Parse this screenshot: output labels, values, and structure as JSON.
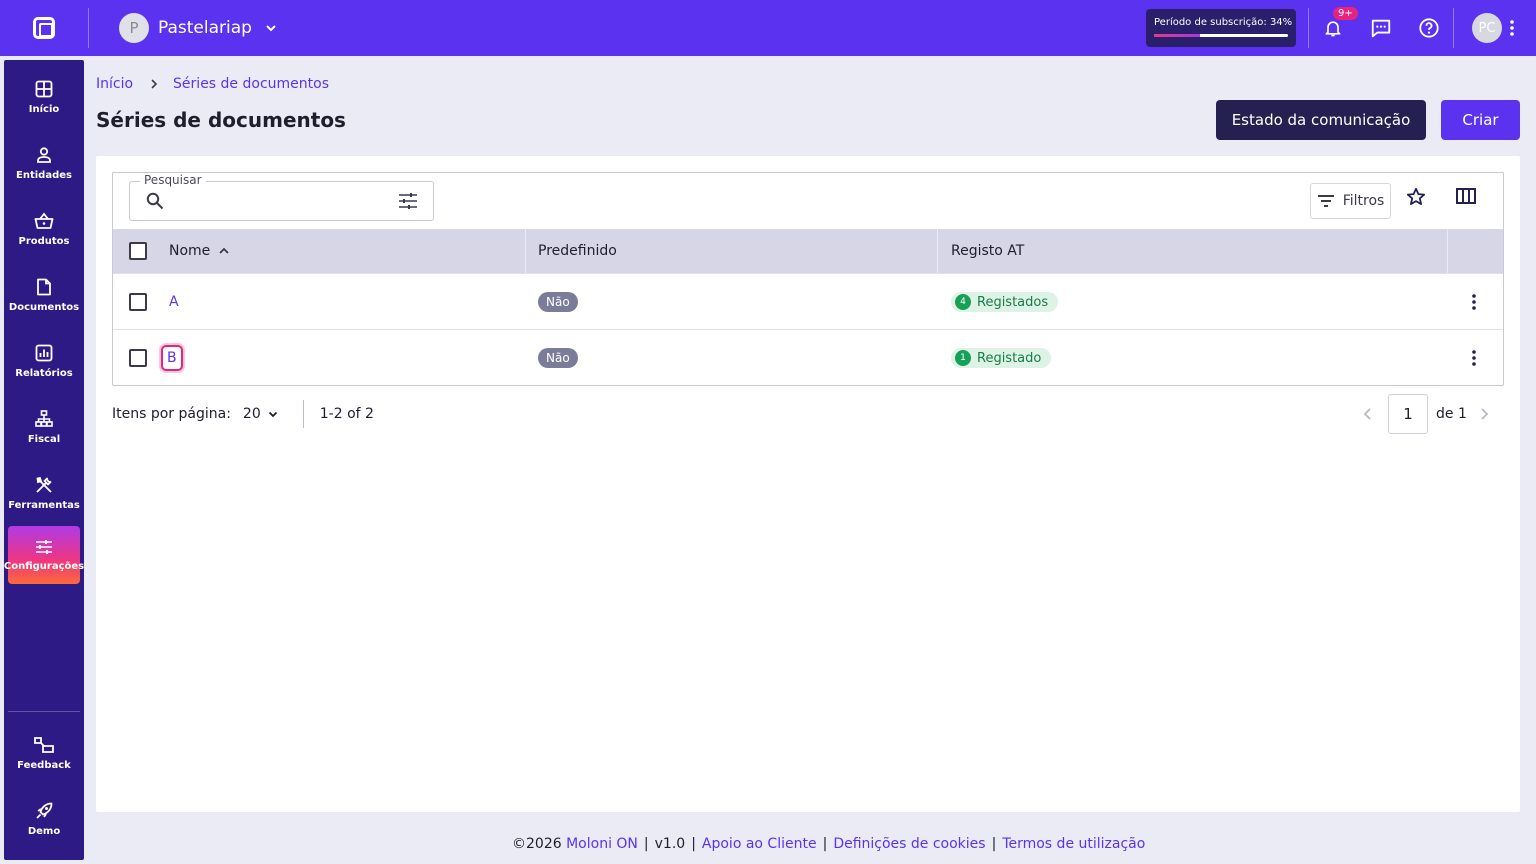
{
  "topbar": {
    "company_initial": "P",
    "company_name": "Pastelariap",
    "subscription_label": "Período de subscrição: 34%",
    "subscription_progress": 34,
    "notifications_badge": "9+",
    "user_initials": "PC"
  },
  "sidebar": {
    "items": [
      {
        "label": "Início",
        "icon": "dashboard-icon"
      },
      {
        "label": "Entidades",
        "icon": "person-icon"
      },
      {
        "label": "Produtos",
        "icon": "basket-icon"
      },
      {
        "label": "Documentos",
        "icon": "document-icon"
      },
      {
        "label": "Relatórios",
        "icon": "chart-icon"
      },
      {
        "label": "Fiscal",
        "icon": "fiscal-icon"
      },
      {
        "label": "Ferramentas",
        "icon": "tools-icon"
      },
      {
        "label": "Configurações",
        "icon": "settings-sliders-icon",
        "active": true
      }
    ],
    "bottom_items": [
      {
        "label": "Feedback",
        "icon": "feedback-icon"
      },
      {
        "label": "Demo",
        "icon": "rocket-icon"
      }
    ]
  },
  "breadcrumb": {
    "home": "Início",
    "current": "Séries de documentos"
  },
  "page": {
    "title": "Séries de documentos",
    "status_button": "Estado da comunicação",
    "create_button": "Criar"
  },
  "toolbar": {
    "search_label": "Pesquisar",
    "search_value": "",
    "filters_label": "Filtros"
  },
  "table": {
    "columns": [
      "Nome",
      "Predefinido",
      "Registo AT"
    ],
    "rows": [
      {
        "name": "A",
        "default": "Não",
        "at_count": "4",
        "at_label": "Registados"
      },
      {
        "name": "B",
        "default": "Não",
        "at_count": "1",
        "at_label": "Registado"
      }
    ]
  },
  "pagination": {
    "per_page_label": "Itens por página:",
    "per_page": "20",
    "range": "1-2 of 2",
    "page": "1",
    "of_label": "de 1"
  },
  "footer": {
    "copyright": "©2026",
    "brand": "Moloni ON",
    "version": "v1.0",
    "support": "Apoio ao Cliente",
    "cookies": "Definições de cookies",
    "terms": "Termos de utilização"
  },
  "colors": {
    "brand": "#5a32f0",
    "sidebar": "#2e1a85",
    "dark_button": "#242050",
    "badge": "#e6247d"
  }
}
